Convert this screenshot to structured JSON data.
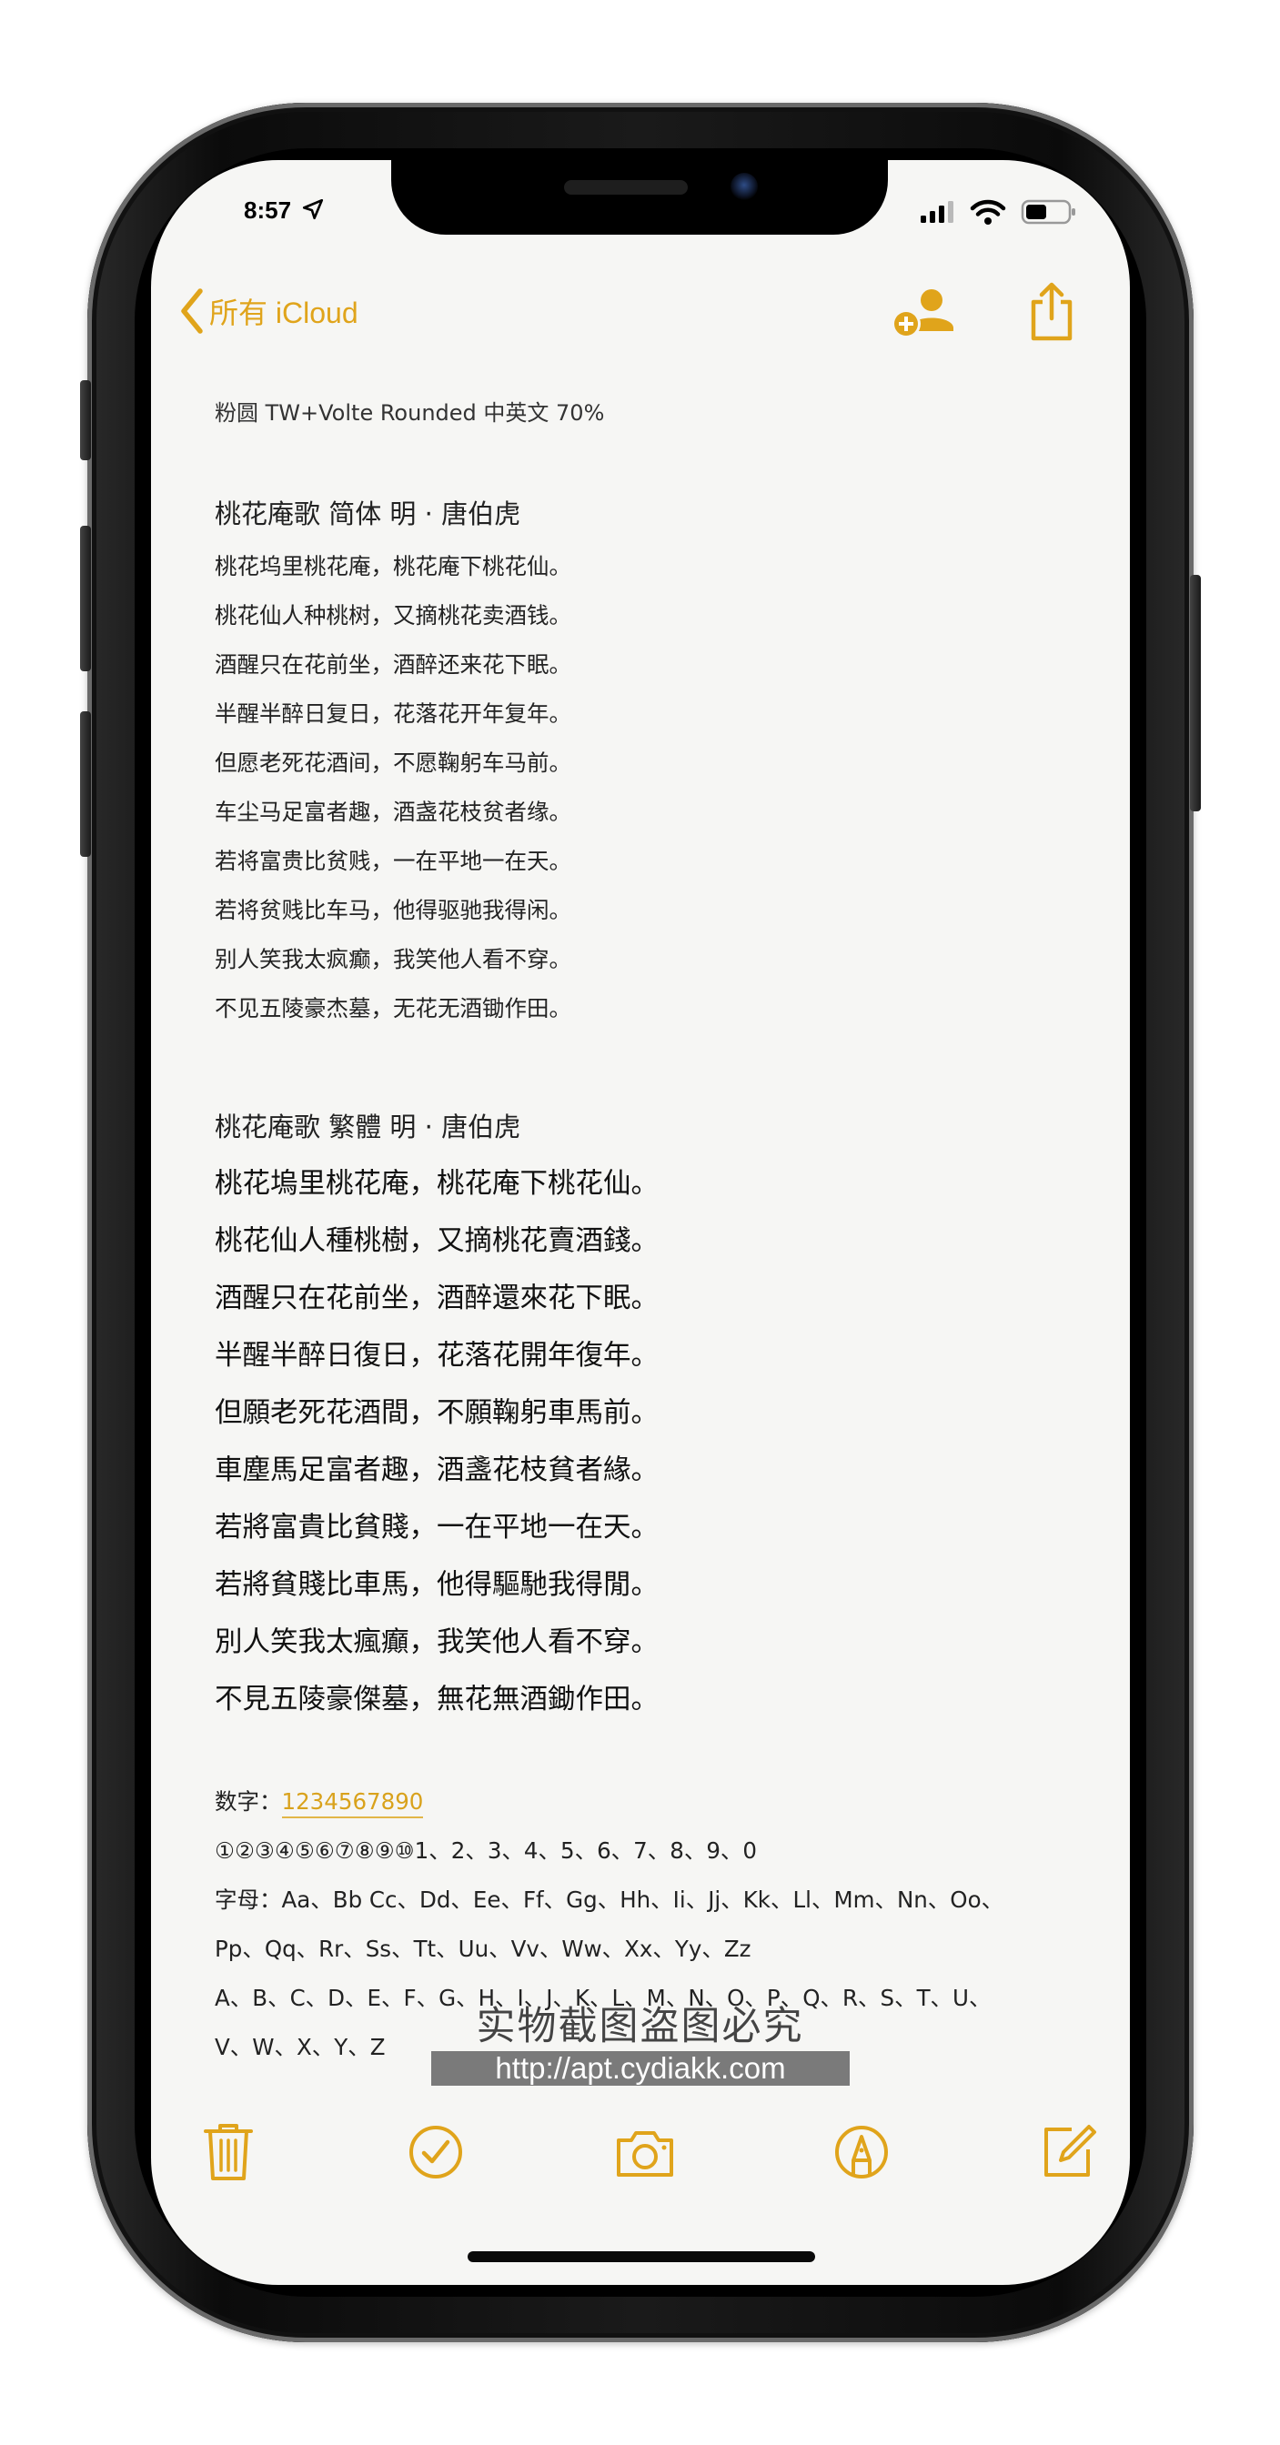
{
  "status": {
    "time": "8:57"
  },
  "nav": {
    "back_label": "所有 iCloud"
  },
  "note": {
    "font_name": "粉圆 TW+Volte Rounded 中英文 70%",
    "simplified": {
      "title": "桃花庵歌 简体  明 · 唐伯虎",
      "lines": [
        "桃花坞里桃花庵，桃花庵下桃花仙。",
        "桃花仙人种桃树，又摘桃花卖酒钱。",
        "酒醒只在花前坐，酒醉还来花下眠。",
        "半醒半醉日复日，花落花开年复年。",
        "但愿老死花酒间，不愿鞠躬车马前。",
        "车尘马足富者趣，酒盏花枝贫者缘。",
        "若将富贵比贫贱，一在平地一在天。",
        "若将贫贱比车马，他得驱驰我得闲。",
        "别人笑我太疯癫，我笑他人看不穿。",
        "不见五陵豪杰墓，无花无酒锄作田。"
      ]
    },
    "traditional": {
      "title": "桃花庵歌 繁體    明 · 唐伯虎",
      "lines": [
        "桃花塢里桃花庵，桃花庵下桃花仙。",
        "桃花仙人種桃樹，又摘桃花賣酒錢。",
        "酒醒只在花前坐，酒醉還來花下眠。",
        "半醒半醉日復日，花落花開年復年。",
        "但願老死花酒間，不願鞠躬車馬前。",
        "車塵馬足富者趣，酒盞花枝貧者緣。",
        "若將富貴比貧賤，一在平地一在天。",
        "若將貧賤比車馬，他得驅馳我得閒。",
        "別人笑我太瘋癲，我笑他人看不穿。",
        "不見五陵豪傑墓，無花無酒鋤作田。"
      ]
    },
    "digits_label": "数字：",
    "digits_value": "1234567890",
    "circled_digits": "①②③④⑤⑥⑦⑧⑨⑩1、2、3、4、5、6、7、8、9、0",
    "letters_line1": "字母：Aa、Bb Cc、Dd、Ee、Ff、Gg、Hh、Ii、Jj、Kk、Ll、Mm、Nn、Oo、",
    "letters_line2": "Pp、Qq、Rr、Ss、Tt、Uu、Vv、Ww、Xx、Yy、Zz",
    "letters_line3": "A、B、C、D、E、F、G、H、I、J、K、L、M、N、O、P、Q、R、S、T、U、",
    "letters_line4": "V、W、X、Y、Z"
  },
  "watermark": {
    "text": "实物截图盗图必究",
    "url": "http://apt.cydiakk.com"
  },
  "colors": {
    "accent": "#e0a41b",
    "paper": "#f6f6f4"
  }
}
